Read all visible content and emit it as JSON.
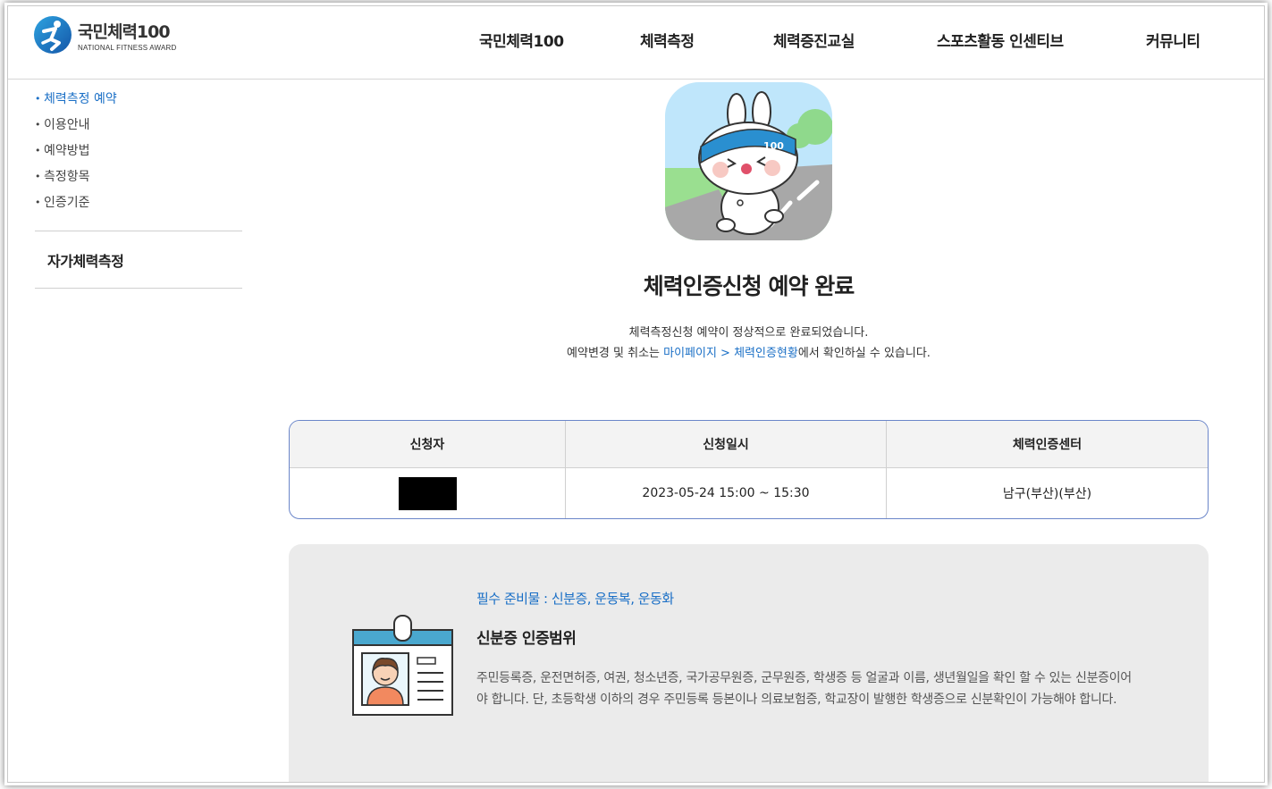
{
  "logo": {
    "title": "국민체력100",
    "subtitle": "NATIONAL FITNESS AWARD"
  },
  "gnb": [
    {
      "label": "국민체력100"
    },
    {
      "label": "체력측정"
    },
    {
      "label": "체력증진교실"
    },
    {
      "label": "스포츠활동 인센티브"
    },
    {
      "label": "커뮤니티"
    }
  ],
  "sidebar": {
    "sub_items": [
      {
        "label": "체력측정 예약",
        "active": true
      },
      {
        "label": "이용안내",
        "active": false
      },
      {
        "label": "예약방법",
        "active": false
      },
      {
        "label": "측정항목",
        "active": false
      },
      {
        "label": "인증기준",
        "active": false
      }
    ],
    "section": "자가체력측정"
  },
  "main": {
    "mascot_badge": "100",
    "title": "체력인증신청 예약 완료",
    "message_line1": "체력측정신청 예약이 정상적으로 완료되었습니다.",
    "message_line2_pre": "예약변경 및 취소는 ",
    "message_line2_link": "마이페이지 > 체력인증현황",
    "message_line2_post": "에서 확인하실 수 있습니다."
  },
  "reservation_table": {
    "headers": [
      "신청자",
      "신청일시",
      "체력인증센터"
    ],
    "row": {
      "applicant": "",
      "datetime": "2023-05-24 15:00 ~ 15:30",
      "center": "남구(부산)(부산)"
    }
  },
  "notice": {
    "preparation": "필수 준비물 : 신분증, 운동복, 운동화",
    "title": "신분증 인증범위",
    "description": "주민등록증, 운전면허증, 여권, 청소년증, 국가공무원증, 군무원증, 학생증 등 얼굴과 이름, 생년월일을 확인 할 수 있는 신분증이어야 합니다. 단, 초등학생 이하의 경우 주민등록 등본이나 의료보험증, 학교장이 발행한 학생증으로 신분확인이 가능해야 합니다."
  },
  "colors": {
    "accent": "#1a6fc6",
    "table_border": "#6b86c9",
    "notice_bg": "#ebebeb"
  }
}
